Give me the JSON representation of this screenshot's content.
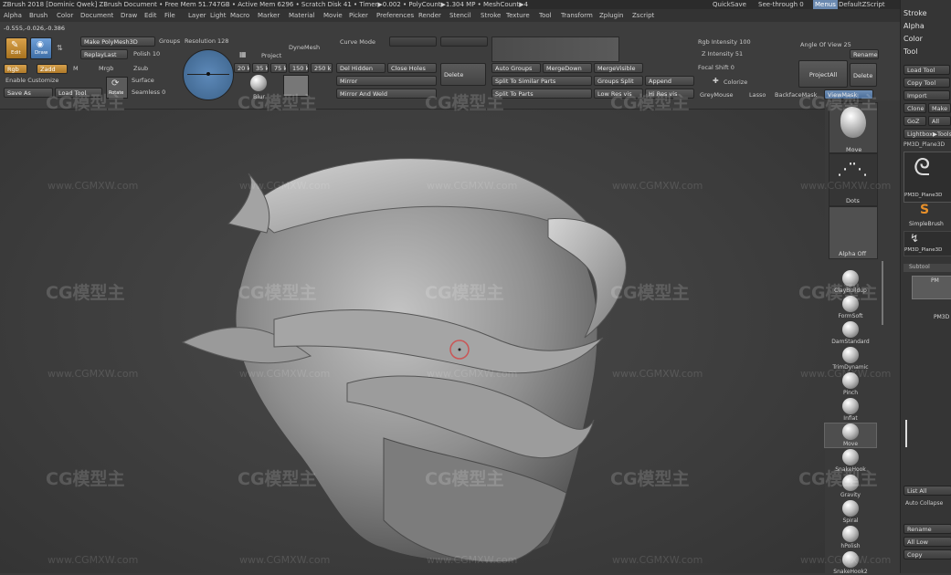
{
  "titlebar": {
    "text": "ZBrush 2018 [Dominic Qwek]   ZBrush Document   • Free Mem 51.747GB • Active Mem 6296 • Scratch Disk 41 • Timer▶0.002 • PolyCount▶1.304 MP • MeshCount▶4",
    "quicksave": "QuickSave",
    "see_through": "See-through  0",
    "menus_btn": "Menus",
    "script": "DefaultZScript"
  },
  "menubar": [
    "Alpha",
    "Brush",
    "Color",
    "Document",
    "Draw",
    "Edit",
    "File",
    "Layer",
    "Light",
    "Macro",
    "Marker",
    "Material",
    "Movie",
    "Picker",
    "Preferences",
    "Render",
    "Stencil",
    "Stroke",
    "Texture",
    "Tool",
    "Transform",
    "Zplugin",
    "Zscript"
  ],
  "coords": "-0.555,-0.026,-0.386",
  "shelf": {
    "edit": "Edit",
    "draw": "Draw",
    "rgb": "Rgb",
    "zadd": "Zadd",
    "m": "M",
    "mrgb": "Mrgb",
    "zsub": "Zsub",
    "make_polymesh": "Make PolyMesh3D",
    "replaylast": "ReplayLast",
    "enable_customize": "Enable Customize",
    "save_as": "Save As",
    "load_tool": "Load Tool",
    "groups": "Groups",
    "polish": "Polish  10",
    "resolution": "Resolution  128",
    "rotate": "Rotate",
    "surface": "Surface",
    "seamless": "Seamless  0",
    "project": "Project",
    "blur": "Blur",
    "dynamesh": "DyneMesh",
    "res_btns": [
      "20 k",
      "35 k",
      "75 k",
      "150 k",
      "250 k"
    ],
    "curve_mode": "Curve Mode",
    "del_hidden": "Del Hidden",
    "close_holes": "Close Holes",
    "mirror": "Mirror",
    "mirror_weld": "Mirror And Weld",
    "delete1": "Delete",
    "auto_groups": "Auto Groups",
    "merge_down": "MergeDown",
    "merge_visible": "MergeVisible",
    "split_similar": "Split To Similar Parts",
    "groups_split": "Groups Split",
    "append": "Append",
    "split_parts": "Split To Parts",
    "low_res": "Low Res vis",
    "hi_res": "Hi Res vis",
    "rgb_intensity": "Rgb Intensity 100",
    "z_intensity": "Z Intensity 51",
    "focal_shift": "Focal Shift 0",
    "angle_of_view": "Angle Of View 25",
    "colorize": "Colorize",
    "projectall": "ProjectAll",
    "rename": "Rename",
    "delete2": "Delete",
    "greymouse": "GreyMouse",
    "lasso": "Lasso",
    "backface": "BackfaceMask",
    "viewmask": "ViewMask"
  },
  "rightcol": {
    "move": "Move",
    "dots": "Dots",
    "alpha_off": "Alpha Off",
    "brushes": [
      "ClayBuildup",
      "FormSoft",
      "DamStandard",
      "TrimDynamic",
      "Pinch",
      "Inflat",
      "Move",
      "SnakeHook",
      "Gravity",
      "Spiral",
      "hPolish",
      "SnakeHook2"
    ]
  },
  "toolpanel": {
    "tray": [
      "Stroke",
      "Alpha",
      "Color",
      "Tool"
    ],
    "load_tool": "Load Tool",
    "copy_tool": "Copy Tool",
    "import": "Import",
    "clone": "Clone",
    "make": "Make P",
    "goz": "GoZ",
    "all": "All",
    "lightbox": "Lightbox▶Tools",
    "current": "PM3D_Plane3D",
    "thumb1": "PM3D_Plane3D",
    "simplebrush": "SimpleBrush",
    "thumb3": "PM3D_Plane3D",
    "subtool": "Subtool",
    "sub1": "PM",
    "sub2": "PM3D",
    "list_all": "List All",
    "auto_collapse": "Auto Collapse",
    "rename": "Rename",
    "all_low": "All Low",
    "copy": "Copy"
  },
  "watermark": {
    "logo": "CG模型主",
    "url": "www.CGMXW.com"
  }
}
